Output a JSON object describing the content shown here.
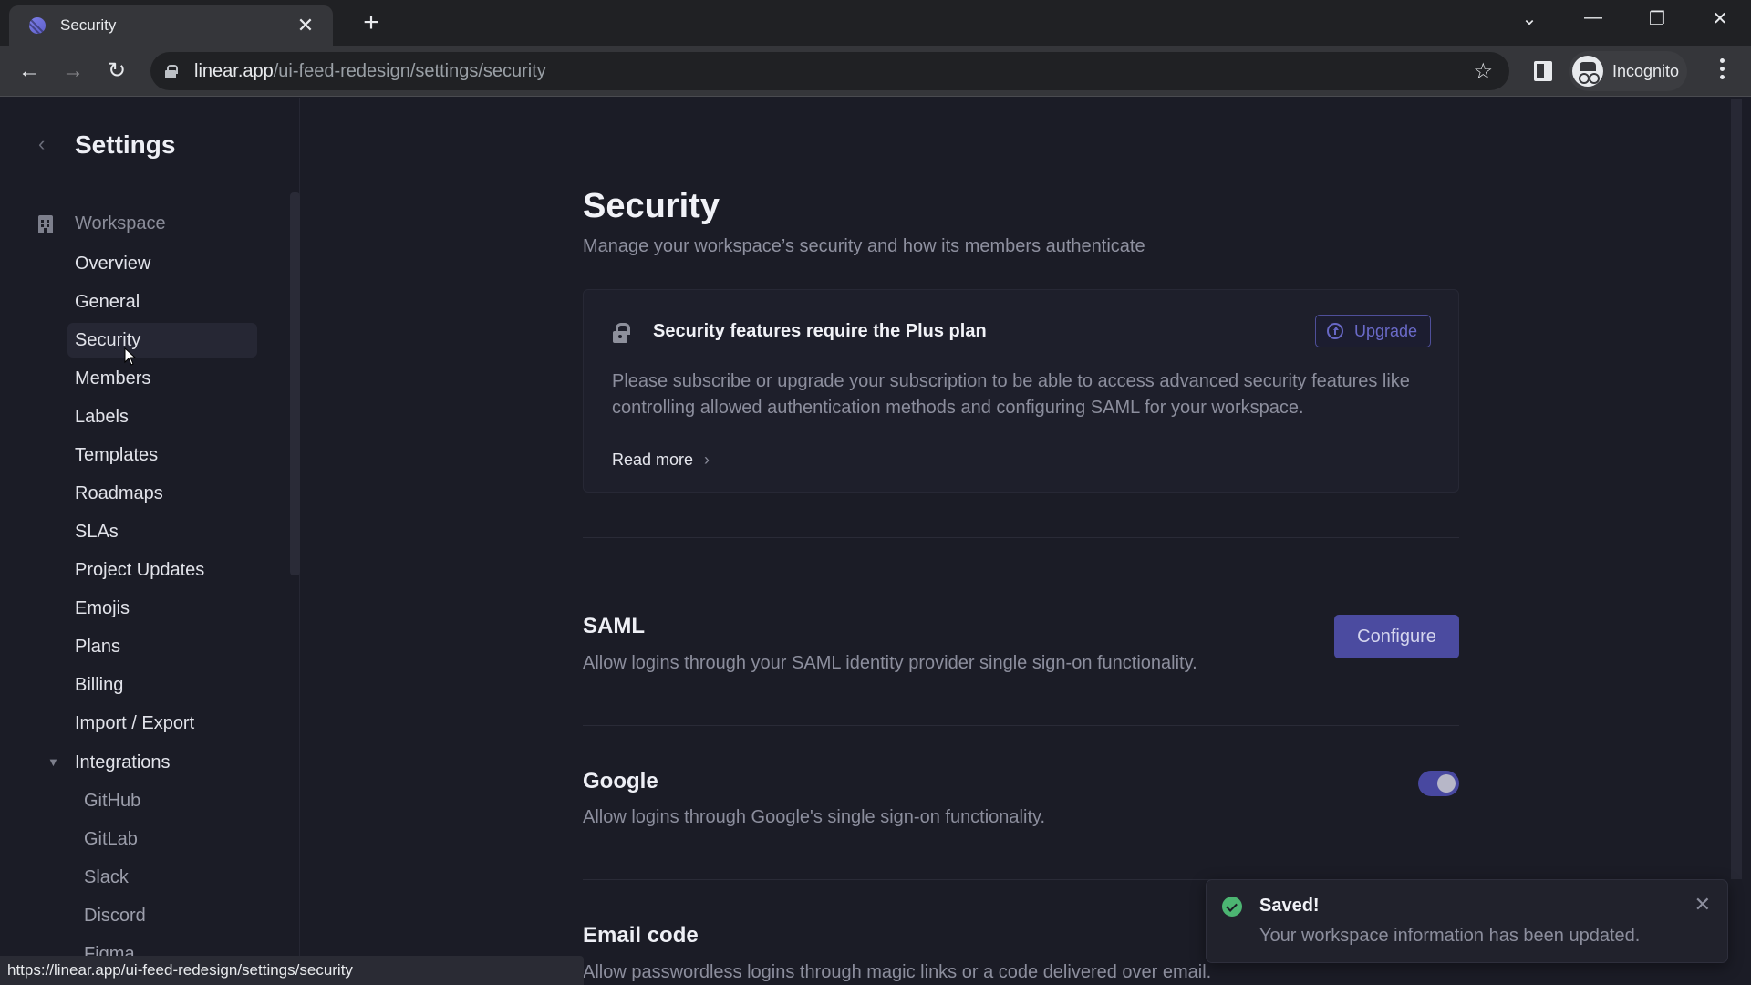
{
  "browser": {
    "tab_title": "Security",
    "tab_close": "✕",
    "new_tab": "+",
    "url_host": "linear.app",
    "url_path": "/ui-feed-redesign/settings/security",
    "profile_label": "Incognito",
    "status_url": "https://linear.app/ui-feed-redesign/settings/security",
    "icons": {
      "back": "←",
      "forward": "→",
      "reload": "↻",
      "star": "☆",
      "tab_search": "⌄",
      "minimize": "—",
      "restore": "❐",
      "close": "✕"
    }
  },
  "sidebar": {
    "back_icon": "‹",
    "title": "Settings",
    "workspace_label": "Workspace",
    "items": [
      {
        "label": "Overview"
      },
      {
        "label": "General"
      },
      {
        "label": "Security",
        "active": true
      },
      {
        "label": "Members"
      },
      {
        "label": "Labels"
      },
      {
        "label": "Templates"
      },
      {
        "label": "Roadmaps"
      },
      {
        "label": "SLAs"
      },
      {
        "label": "Project Updates"
      },
      {
        "label": "Emojis"
      },
      {
        "label": "Plans"
      },
      {
        "label": "Billing"
      },
      {
        "label": "Import / Export"
      }
    ],
    "integrations": {
      "label": "Integrations",
      "expand_icon": "▼",
      "items": [
        {
          "label": "GitHub"
        },
        {
          "label": "GitLab"
        },
        {
          "label": "Slack"
        },
        {
          "label": "Discord"
        },
        {
          "label": "Figma"
        }
      ]
    }
  },
  "main": {
    "title": "Security",
    "subtitle": "Manage your workspace’s security and how its members authenticate",
    "plan_card": {
      "title": "Security features require the Plus plan",
      "upgrade_label": "Upgrade",
      "body": "Please subscribe or upgrade your subscription to be able to access advanced security features like controlling allowed authentication methods and configuring SAML for your workspace.",
      "read_more": "Read more",
      "read_more_chevron": "›"
    },
    "sections": [
      {
        "title": "SAML",
        "description": "Allow logins through your SAML identity provider single sign-on functionality.",
        "action_label": "Configure"
      },
      {
        "title": "Google",
        "description": "Allow logins through Google's single sign-on functionality.",
        "toggle_on": true
      },
      {
        "title": "Email code",
        "description": "Allow passwordless logins through magic links or a code delivered over email."
      }
    ]
  },
  "toast": {
    "title": "Saved!",
    "message": "Your workspace information has been updated.",
    "close_icon": "✕"
  },
  "colors": {
    "accent": "#4b4ba0",
    "background": "#1b1c26",
    "success": "#4cb572"
  }
}
